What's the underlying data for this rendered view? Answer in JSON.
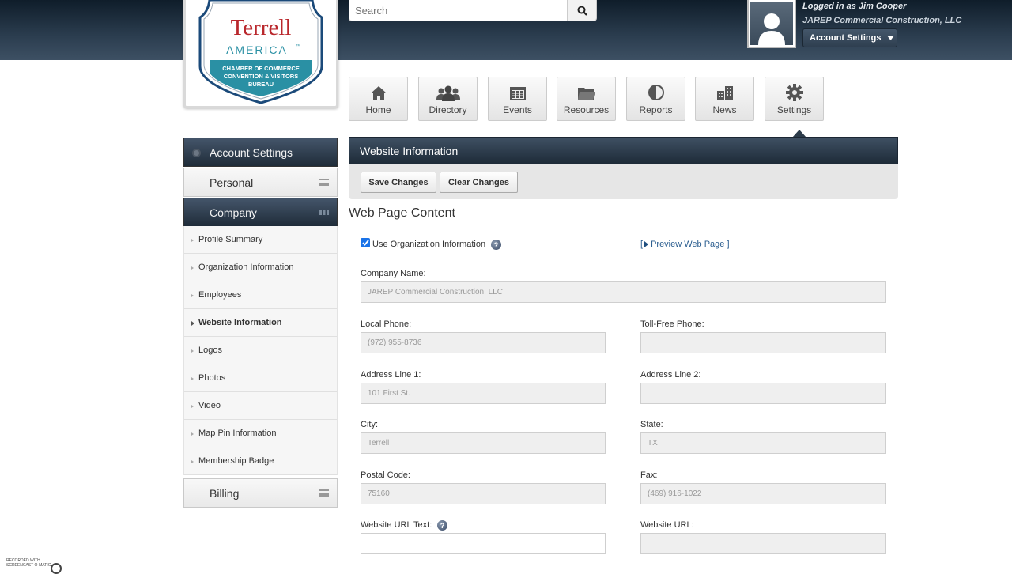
{
  "brand": {
    "logo_line1": "Terrell",
    "logo_line2": "AMERICA",
    "logo_tm": "™",
    "logo_line3": "CHAMBER OF COMMERCE",
    "logo_line4": "CONVENTION & VISITORS",
    "logo_line5": "BUREAU",
    "colors": {
      "red": "#b9272c",
      "teal": "#2a90a4",
      "blue": "#1b4a7a"
    }
  },
  "search": {
    "placeholder": "Search",
    "icon": "search-icon"
  },
  "user": {
    "logged_in": "Logged in as Jim Cooper",
    "company": "JAREP Commercial Construction, LLC",
    "account_button": "Account Settings"
  },
  "nav": [
    {
      "label": "Home",
      "icon": "home-icon"
    },
    {
      "label": "Directory",
      "icon": "people-icon"
    },
    {
      "label": "Events",
      "icon": "calendar-icon"
    },
    {
      "label": "Resources",
      "icon": "folder-icon"
    },
    {
      "label": "Reports",
      "icon": "pie-chart-icon"
    },
    {
      "label": "News",
      "icon": "building-icon"
    },
    {
      "label": "Settings",
      "icon": "gear-icon"
    }
  ],
  "sidebar": {
    "account_settings": "Account Settings",
    "personal": "Personal",
    "company": "Company",
    "billing": "Billing",
    "items": [
      "Profile Summary",
      "Organization Information",
      "Employees",
      "Website Information",
      "Logos",
      "Photos",
      "Video",
      "Map Pin Information",
      "Membership Badge"
    ],
    "active_item": "Website Information"
  },
  "panel": {
    "title": "Website Information",
    "save": "Save Changes",
    "clear": "Clear Changes",
    "section": "Web Page Content",
    "use_org_info": "Use Organization Information",
    "use_org_checked": true,
    "preview_open": "[",
    "preview": "Preview Web Page",
    "preview_close": "]"
  },
  "form": {
    "company_name": {
      "label": "Company Name:",
      "value": "JAREP Commercial Construction, LLC"
    },
    "local_phone": {
      "label": "Local Phone:",
      "value": "(972) 955-8736"
    },
    "toll_free": {
      "label": "Toll-Free Phone:",
      "value": ""
    },
    "address1": {
      "label": "Address Line 1:",
      "value": "101 First St."
    },
    "address2": {
      "label": "Address Line 2:",
      "value": ""
    },
    "city": {
      "label": "City:",
      "value": "Terrell"
    },
    "state": {
      "label": "State:",
      "value": "TX"
    },
    "postal": {
      "label": "Postal Code:",
      "value": "75160"
    },
    "fax": {
      "label": "Fax:",
      "value": "(469) 916-1022"
    },
    "url_text": {
      "label": "Website URL Text:",
      "value": ""
    },
    "url": {
      "label": "Website URL:",
      "value": ""
    }
  },
  "watermark": {
    "line1": "RECORDED WITH",
    "line2": "SCREENCAST-O-MATIC"
  }
}
